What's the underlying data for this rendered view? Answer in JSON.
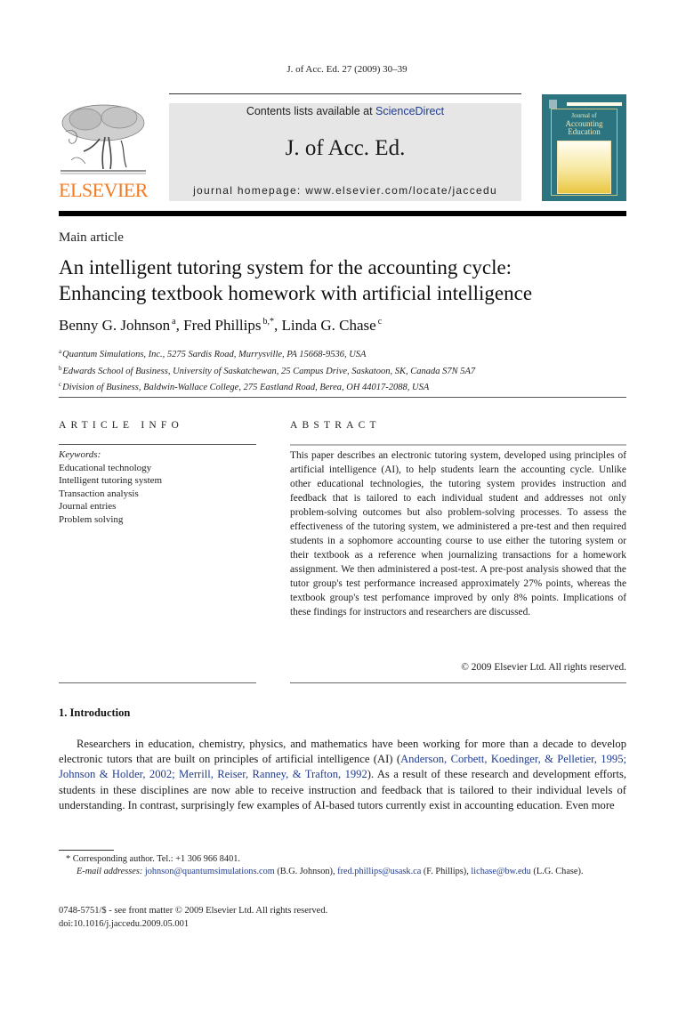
{
  "header": {
    "citation": "J. of Acc. Ed. 27 (2009) 30–39",
    "publisher_logo_text": "ELSEVIER",
    "contents_prefix": "Contents lists available at ",
    "contents_link": "ScienceDirect",
    "journal_title": "J. of Acc. Ed.",
    "homepage": "journal homepage: www.elsevier.com/locate/jaccedu",
    "cover": {
      "title_line1": "Journal of",
      "title_line2": "Accounting",
      "title_line3": "Education"
    },
    "colors": {
      "elsevier_orange": "#f47920",
      "link_blue": "#1f3c8f",
      "banner_gray": "#e6e6e6",
      "cover_teal": "#2c7480"
    }
  },
  "article": {
    "type": "Main article",
    "title_line1": "An intelligent tutoring system for the accounting cycle:",
    "title_line2": "Enhancing textbook homework with artificial intelligence",
    "authors": [
      {
        "name": "Benny G. Johnson",
        "sup": "a"
      },
      {
        "name": "Fred Phillips",
        "sup": "b,*"
      },
      {
        "name": "Linda G. Chase",
        "sup": "c"
      }
    ],
    "affiliations": [
      {
        "sup": "a",
        "text": "Quantum Simulations, Inc., 5275 Sardis Road, Murrysville, PA 15668-9536, USA"
      },
      {
        "sup": "b",
        "text": "Edwards School of Business, University of Saskatchewan, 25 Campus Drive, Saskatoon, SK, Canada S7N 5A7"
      },
      {
        "sup": "c",
        "text": "Division of Business, Baldwin-Wallace College, 275 Eastland Road, Berea, OH 44017-2088, USA"
      }
    ]
  },
  "article_info": {
    "label": "ARTICLE INFO",
    "keywords_heading": "Keywords:",
    "keywords": [
      "Educational technology",
      "Intelligent tutoring system",
      "Transaction analysis",
      "Journal entries",
      "Problem solving"
    ]
  },
  "abstract": {
    "label": "ABSTRACT",
    "text": "This paper describes an electronic tutoring system, developed using principles of artificial intelligence (AI), to help students learn the accounting cycle. Unlike other educational technologies, the tutoring system provides instruction and feedback that is tailored to each individual student and addresses not only problem-solving outcomes but also problem-solving processes. To assess the effec­tiveness of the tutoring system, we administered a pre-test and then required students in a sophomore accounting course to use either the tutoring system or their textbook as a reference when journalizing transactions for a homework assignment. We then administered a post-test. A pre-post analysis showed that the tutor group's test performance increased approximately 27% points, whereas the textbook group's test perfomance improved by only 8% points. Implications of these findings for instructors and researchers are discussed.",
    "copyright": "© 2009 Elsevier Ltd. All rights reserved."
  },
  "introduction": {
    "heading": "1. Introduction",
    "text_before_refs": "Researchers in education, chemistry, physics, and mathematics have been working for more than a decade to develop electronic tutors that are built on principles of artificial intelligence (AI) (",
    "refs": [
      "Anderson, Corbett, Koedinger, & Pelletier, 1995",
      "Johnson & Holder, 2002",
      "Merrill, Reiser, Ranney, & Trafton, 1992"
    ],
    "ref_separator": "; ",
    "text_after_refs": "). As a result of these research and development efforts, students in these disciplines are now able to receive instruction and feedback that is tailored to their individual levels of understanding. In con­trast, surprisingly few examples of AI-based tutors currently exist in accounting education. Even more"
  },
  "footnotes": {
    "corresponding": "* Corresponding author. Tel.: +1 306 966 8401.",
    "email_label": "E-mail addresses:",
    "emails": [
      {
        "address": "johnson@quantumsimulations.com",
        "owner": "(B.G. Johnson)"
      },
      {
        "address": "fred.phillips@usask.ca",
        "owner": "(F. Phillips)"
      },
      {
        "address": "lichase@bw.edu",
        "owner": "(L.G. Chase)."
      }
    ]
  },
  "front_matter": {
    "issn_line": "0748-5751/$ - see front matter © 2009 Elsevier Ltd. All rights reserved.",
    "doi": "doi:10.1016/j.jaccedu.2009.05.001"
  }
}
